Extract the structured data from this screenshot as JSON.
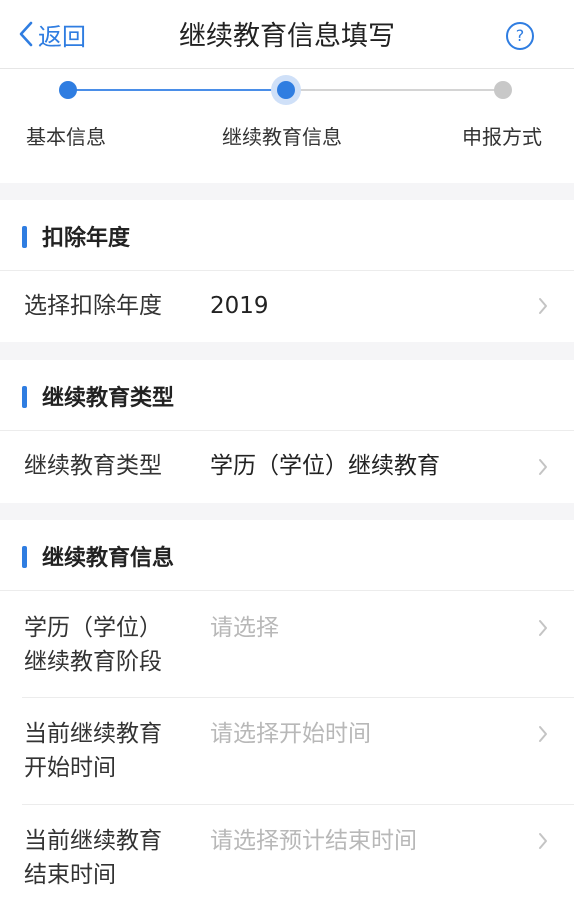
{
  "nav": {
    "back_label": "返回",
    "title": "继续教育信息填写",
    "help_symbol": "?"
  },
  "steps": [
    {
      "label": "基本信息",
      "state": "done"
    },
    {
      "label": "继续教育信息",
      "state": "current"
    },
    {
      "label": "申报方式",
      "state": "todo"
    }
  ],
  "section_year": {
    "title": "扣除年度",
    "row_label": "选择扣除年度",
    "row_value": "2019"
  },
  "section_type": {
    "title": "继续教育类型",
    "row_label": "继续教育类型",
    "row_value": "学历（学位）继续教育"
  },
  "section_info": {
    "title": "继续教育信息",
    "rows": [
      {
        "label_line1": "学历（学位）",
        "label_line2": "继续教育阶段",
        "placeholder": "请选择"
      },
      {
        "label_line1": "当前继续教育",
        "label_line2": "开始时间",
        "placeholder": "请选择开始时间"
      },
      {
        "label_line1": "当前继续教育",
        "label_line2": "结束时间",
        "placeholder": "请选择预计结束时间"
      }
    ]
  },
  "colors": {
    "accent": "#2f7de1",
    "placeholder": "#b8b8b8",
    "background": "#f5f5f7"
  }
}
